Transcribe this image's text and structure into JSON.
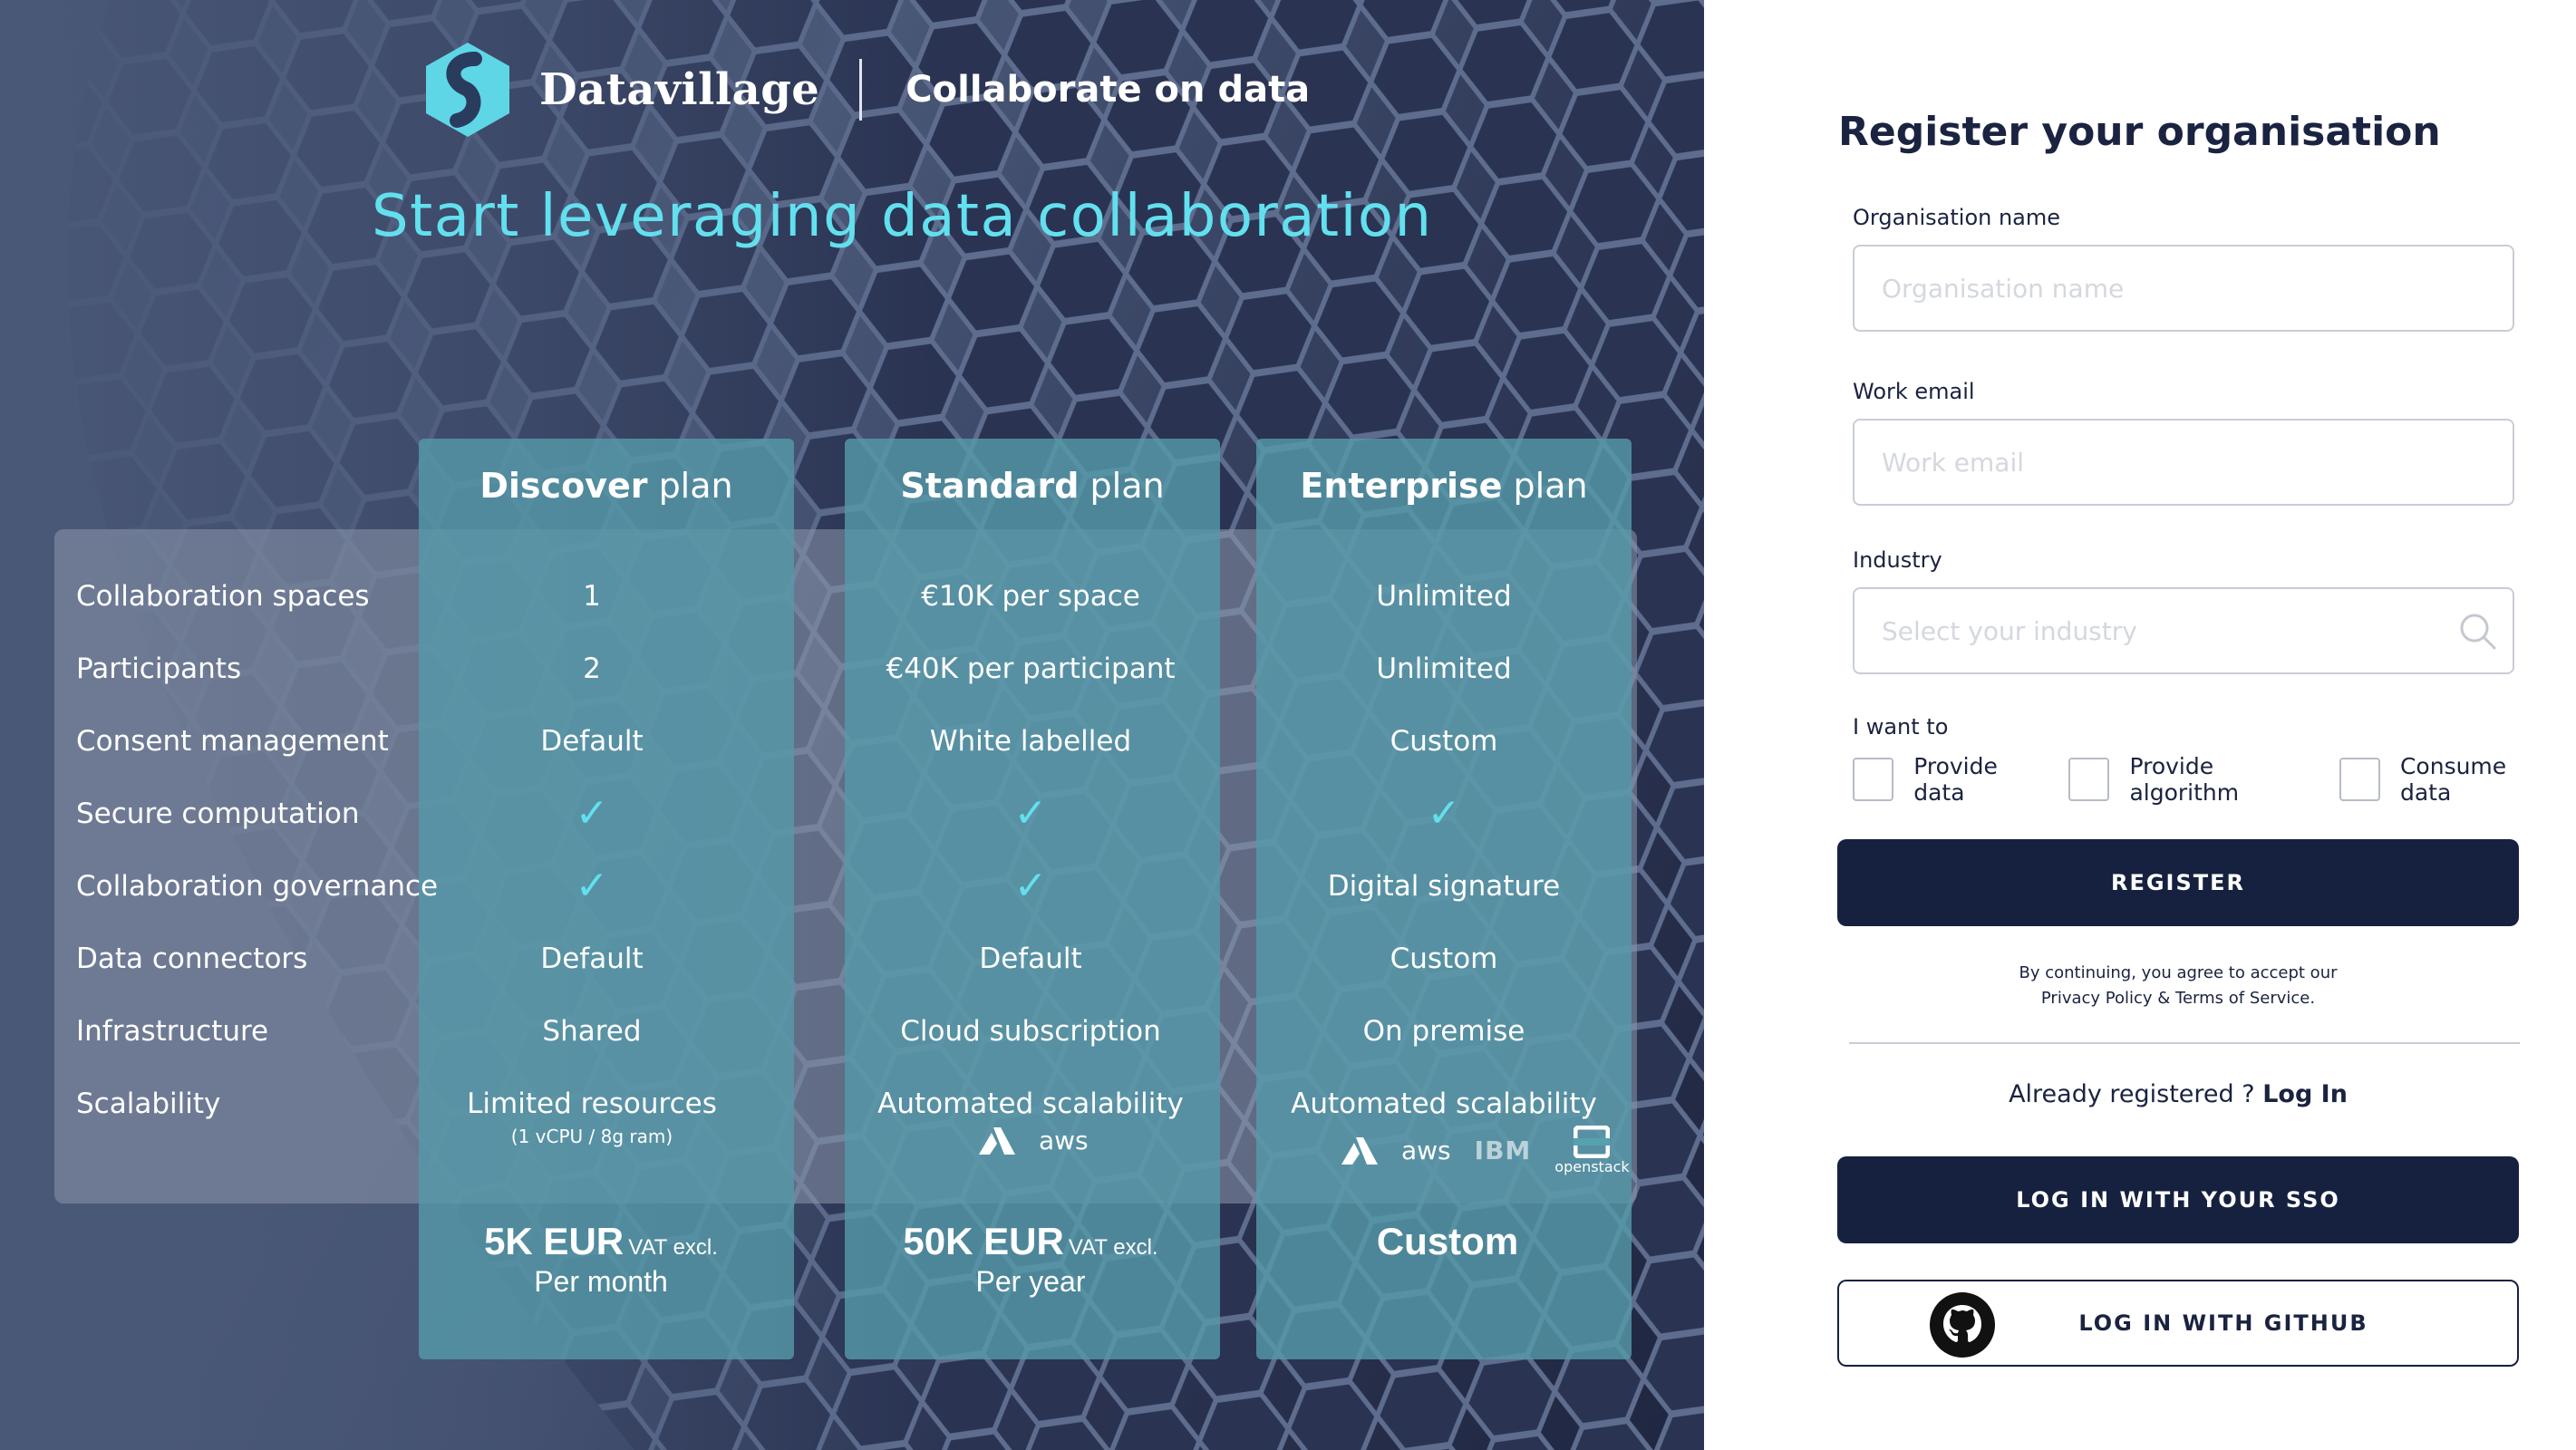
{
  "brand": {
    "name": "Datavillage",
    "tagline": "Collaborate on data"
  },
  "headline": "Start leveraging data collaboration",
  "plans": [
    {
      "name_bold": "Discover",
      "name_suffix": "plan",
      "values": [
        "1",
        "2",
        "Default",
        "check",
        "check",
        "Default",
        "Shared",
        "Limited resources"
      ],
      "scalability_note": "(1 vCPU / 8g ram)",
      "price": "5K EUR",
      "price_vat": "VAT excl.",
      "period": "Per month"
    },
    {
      "name_bold": "Standard",
      "name_suffix": "plan",
      "values": [
        "€10K per space",
        "€40K per participant",
        "White labelled",
        "check",
        "check",
        "Default",
        "Cloud subscription",
        "Automated scalability"
      ],
      "clouds": [
        "azure-logo",
        "aws-logo"
      ],
      "price": "50K EUR",
      "price_vat": "VAT excl.",
      "period": "Per year"
    },
    {
      "name_bold": "Enterprise",
      "name_suffix": "plan",
      "values": [
        "Unlimited",
        "Unlimited",
        "Custom",
        "check",
        "Digital signature",
        "Custom",
        "On premise",
        "Automated scalability"
      ],
      "clouds": [
        "azure-logo",
        "aws-logo",
        "ibm-logo",
        "openstack-logo"
      ],
      "price": "Custom",
      "price_vat": "",
      "period": ""
    }
  ],
  "features": [
    "Collaboration spaces",
    "Participants",
    "Consent management",
    "Secure computation",
    "Collaboration governance",
    "Data connectors",
    "Infrastructure",
    "Scalability"
  ],
  "cloud_text": {
    "aws": "aws",
    "ibm": "IBM",
    "openstack": "openstack"
  },
  "form": {
    "title": "Register your organisation",
    "org_label": "Organisation name",
    "org_placeholder": "Organisation name",
    "email_label": "Work email",
    "email_placeholder": "Work email",
    "industry_label": "Industry",
    "industry_placeholder": "Select your industry",
    "want_label": "I want to",
    "options": [
      "Provide data",
      "Provide algorithm",
      "Consume data"
    ],
    "register_label": "REGISTER",
    "terms_line1": "By continuing, you agree to accept our",
    "terms_line2": "Privacy Policy & Terms of Service.",
    "already_text": "Already registered ?",
    "login_link": "Log In",
    "sso_label": "LOG IN WITH YOUR SSO",
    "github_label": "LOG IN WITH GITHUB"
  },
  "colors": {
    "accent": "#62e0ee",
    "navy": "#162140",
    "plan_column": "#56a0b0"
  }
}
